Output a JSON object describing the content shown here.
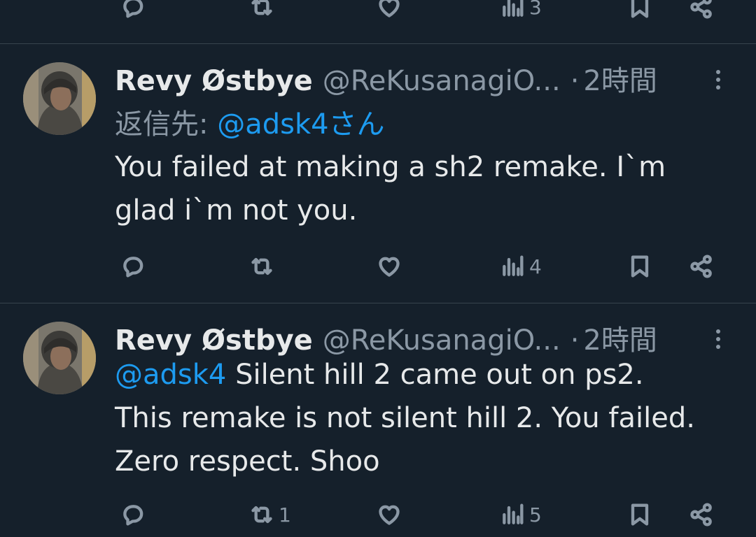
{
  "top_actions": {
    "views_count": "3"
  },
  "tweets": [
    {
      "display_name": "Revy Østbye",
      "handle": "@ReKusanagiO...",
      "separator": "·",
      "time": "2時間",
      "reply_prefix": "返信先:",
      "reply_mention": "@adsk4さん",
      "body_lines": [
        "You failed at making a sh2 remake. I`m",
        "glad i`m not you."
      ],
      "reply_count": "",
      "retweet_count": "",
      "like_count": "",
      "views_count": "4"
    },
    {
      "display_name": "Revy Østbye",
      "handle": "@ReKusanagiO...",
      "separator": "·",
      "time": "2時間",
      "mention": "@adsk4",
      "body_first_rest": " Silent hill 2 came out on ps2.",
      "body_lines": [
        "This remake is not silent hill 2. You failed.",
        "Zero respect. Shoo"
      ],
      "reply_count": "",
      "retweet_count": "1",
      "like_count": "",
      "views_count": "5"
    }
  ],
  "icons": {
    "reply": "reply-icon",
    "retweet": "retweet-icon",
    "like": "heart-icon",
    "views": "views-icon",
    "bookmark": "bookmark-icon",
    "share": "share-icon",
    "more": "more-icon"
  },
  "colors": {
    "background": "#15202b",
    "text": "#e7e9ea",
    "muted": "#8b98a5",
    "link": "#1d9bf0",
    "divider": "#38444d"
  }
}
